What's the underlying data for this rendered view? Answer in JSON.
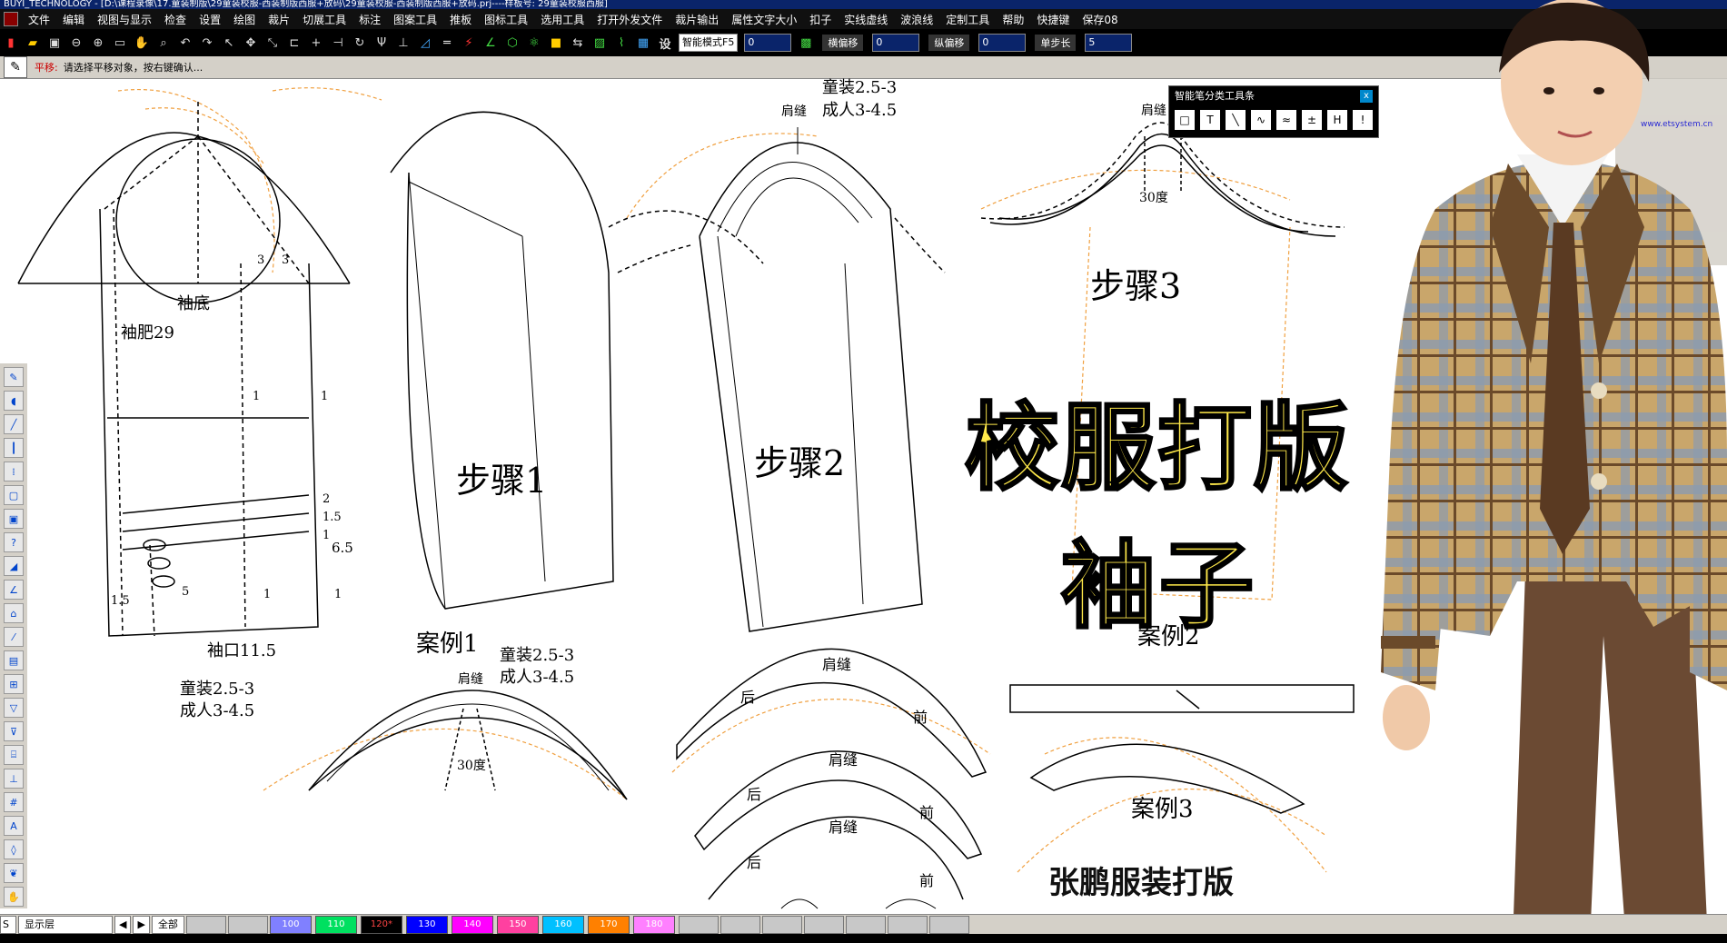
{
  "window": {
    "title": "BUYI_TECHNOLOGY - [D:\\课程录像\\17.童装制版\\29童装校服-西装制版西服+放码\\29童装校服-西装制版西服+放码.prj----样板号: 29童装校服西服]"
  },
  "menu": {
    "items": [
      "文件",
      "编辑",
      "视图与显示",
      "检查",
      "设置",
      "绘图",
      "裁片",
      "切展工具",
      "标注",
      "图案工具",
      "推板",
      "图标工具",
      "选用工具",
      "打开外发文件",
      "裁片输出",
      "属性文字大小",
      "扣子",
      "实线虚线",
      "波浪线",
      "定制工具",
      "帮助",
      "快捷键",
      "保存08"
    ]
  },
  "toolbar": {
    "mode_select": "智能模式F5",
    "mode_value": "0",
    "h_offset_label": "横偏移",
    "h_offset_value": "0",
    "v_offset_label": "纵偏移",
    "v_offset_value": "0",
    "step_label": "单步长",
    "step_value": "5",
    "settings_label": "设"
  },
  "status": {
    "mode": "平移:",
    "message": "请选择平移对象，按右键确认..."
  },
  "float_panel": {
    "title": "智能笔分类工具条",
    "close": "x",
    "tools": [
      "□",
      "T",
      "╲",
      "∿",
      "≈",
      "±",
      "H",
      "!"
    ]
  },
  "drawing": {
    "labels": {
      "sleeve_bottom": "袖底",
      "sleeve_width": "袖肥29",
      "cuff": "袖口11.5",
      "kids1": "童装2.5-3",
      "adult1": "成人3-4.5",
      "case1": "案例1",
      "kids2": "童装2.5-3",
      "adult2": "成人3-4.5",
      "shoulder_seam1": "肩缝",
      "deg30_a": "30度",
      "step1": "步骤1",
      "step2": "步骤2",
      "step3": "步骤3",
      "kids_top": "童装2.5-3",
      "adult_top": "成人3-4.5",
      "shoulder_seam_top": "肩缝",
      "shoulder_seam_step3": "肩缝",
      "deg30_b": "30度",
      "case2": "案例2",
      "case3": "案例3",
      "shoulder_seam_c2a": "肩缝",
      "shoulder_seam_c2b": "肩缝",
      "shoulder_seam_c2c": "肩缝",
      "back1": "后",
      "front1": "前",
      "back2": "后",
      "front2": "前",
      "back3": "后",
      "front3": "前",
      "dim_3a": "3",
      "dim_3b": "3",
      "dim_1a": "1",
      "dim_1b": "1",
      "dim_2": "2",
      "dim_1_5a": "1.5",
      "dim_1c": "1",
      "dim_6_5": "6.5",
      "dim_1_5b": "1.5",
      "dim_5": "5",
      "dim_1d": "1",
      "dim_1e": "1"
    }
  },
  "overlay": {
    "headline1": "校服打版",
    "headline2": "袖子",
    "author": "张鹏服装打版",
    "website": "www.etsystem.cn"
  },
  "bottombar": {
    "layer_label": "显示层",
    "all_label": "全部",
    "sizes": [
      {
        "label": "100",
        "color": "#8080ff"
      },
      {
        "label": "110",
        "color": "#00e060"
      },
      {
        "label": "120*",
        "color": "#000000"
      },
      {
        "label": "130",
        "color": "#0000ff"
      },
      {
        "label": "140",
        "color": "#ff00ff"
      },
      {
        "label": "150",
        "color": "#ff40a0"
      },
      {
        "label": "160",
        "color": "#00c0ff"
      },
      {
        "label": "170",
        "color": "#ff8000"
      },
      {
        "label": "180",
        "color": "#ff80ff"
      }
    ]
  },
  "colors": {
    "headline_fill": "#ffe94a",
    "pattern_line": "#000000",
    "grading_line": "#f0a040"
  }
}
